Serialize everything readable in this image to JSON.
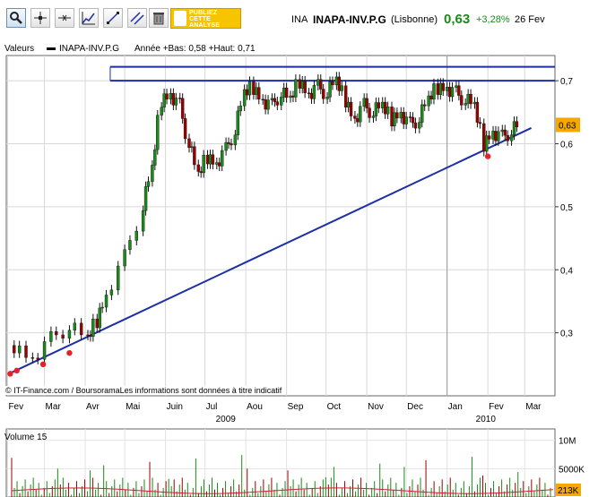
{
  "header": {
    "code": "INA",
    "name": "INAPA-INV.P.G",
    "exchange": "(Lisbonne)",
    "price": "0,63",
    "change": "+3,28%",
    "date": "26 Fev"
  },
  "ad": {
    "line1": "PUBLIEZ",
    "line2": "CETTE",
    "line3": "ANALYSE"
  },
  "toolbar_icons": [
    "zoom-icon",
    "cursor-icon",
    "crosshair-icon",
    "indicator-icon",
    "trendline-icon",
    "parallel-lines-icon",
    "trash-icon"
  ],
  "legend": {
    "label": "Valeurs",
    "series": "INAPA-INV.P.G",
    "stats": "Année +Bas: 0,58 +Haut: 0,71"
  },
  "credit": "© IT-Finance.com / BoursoramaLes informations sont données à titre indicatif",
  "colors": {
    "up": "#1a8a1a",
    "down": "#990000",
    "line": "#1d2fa5",
    "marker": "#e8202a",
    "price_tag": "#f5a800"
  },
  "chart_data": {
    "type": "candlestick",
    "xlabels": [
      "Fev",
      "Mar",
      "Avr",
      "Mai",
      "Juin",
      "Jul",
      "Aou",
      "Sep",
      "Oct",
      "Nov",
      "Dec",
      "Jan",
      "Fev",
      "Mar"
    ],
    "year_labels": [
      "2009",
      "2010"
    ],
    "y_ticks": [
      "0,7",
      "0,6",
      "0,5",
      "0,4",
      "0,3"
    ],
    "ylim": [
      0.2,
      0.74
    ],
    "last_price_label": "0,63",
    "close_series": [
      [
        "2009-02-06",
        0.28
      ],
      [
        "2009-02-20",
        0.26
      ],
      [
        "2009-03-06",
        0.29
      ],
      [
        "2009-03-20",
        0.31
      ],
      [
        "2009-04-03",
        0.29
      ],
      [
        "2009-04-10",
        0.32
      ],
      [
        "2009-04-17",
        0.36
      ],
      [
        "2009-05-01",
        0.42
      ],
      [
        "2009-05-15",
        0.5
      ],
      [
        "2009-05-22",
        0.56
      ],
      [
        "2009-05-29",
        0.67
      ],
      [
        "2009-06-05",
        0.68
      ],
      [
        "2009-06-12",
        0.66
      ],
      [
        "2009-06-19",
        0.6
      ],
      [
        "2009-06-26",
        0.55
      ],
      [
        "2009-07-03",
        0.58
      ],
      [
        "2009-07-10",
        0.57
      ],
      [
        "2009-07-17",
        0.59
      ],
      [
        "2009-07-24",
        0.62
      ],
      [
        "2009-07-31",
        0.68
      ],
      [
        "2009-08-07",
        0.69
      ],
      [
        "2009-08-14",
        0.67
      ],
      [
        "2009-08-21",
        0.66
      ],
      [
        "2009-08-28",
        0.68
      ],
      [
        "2009-09-04",
        0.67
      ],
      [
        "2009-09-11",
        0.7
      ],
      [
        "2009-09-18",
        0.68
      ],
      [
        "2009-09-25",
        0.69
      ],
      [
        "2009-10-02",
        0.68
      ],
      [
        "2009-10-09",
        0.7
      ],
      [
        "2009-10-16",
        0.67
      ],
      [
        "2009-10-23",
        0.64
      ],
      [
        "2009-10-30",
        0.66
      ],
      [
        "2009-11-06",
        0.65
      ],
      [
        "2009-11-13",
        0.66
      ],
      [
        "2009-11-20",
        0.64
      ],
      [
        "2009-11-27",
        0.65
      ],
      [
        "2009-12-04",
        0.63
      ],
      [
        "2009-12-11",
        0.64
      ],
      [
        "2009-12-18",
        0.67
      ],
      [
        "2009-12-25",
        0.69
      ],
      [
        "2010-01-01",
        0.69
      ],
      [
        "2010-01-08",
        0.68
      ],
      [
        "2010-01-15",
        0.67
      ],
      [
        "2010-01-22",
        0.66
      ],
      [
        "2010-01-29",
        0.6
      ],
      [
        "2010-02-05",
        0.62
      ],
      [
        "2010-02-12",
        0.61
      ],
      [
        "2010-02-19",
        0.62
      ],
      [
        "2010-02-26",
        0.63
      ]
    ],
    "resistance_lines": [
      0.722,
      0.7
    ],
    "support_line": {
      "from": [
        "2009-02-01",
        0.234
      ],
      "to": [
        "2010-03-06",
        0.625
      ]
    },
    "support_touches": [
      [
        "2009-02-03",
        0.235
      ],
      [
        "2009-02-08",
        0.24
      ],
      [
        "2009-02-28",
        0.25
      ],
      [
        "2009-03-20",
        0.268
      ],
      [
        "2010-02-01",
        0.58
      ]
    ],
    "volume": {
      "label": "Volume 15",
      "y_ticks": [
        "10M",
        "5000K"
      ],
      "last_tag": "213K",
      "ylim": [
        0,
        12000000
      ]
    }
  }
}
